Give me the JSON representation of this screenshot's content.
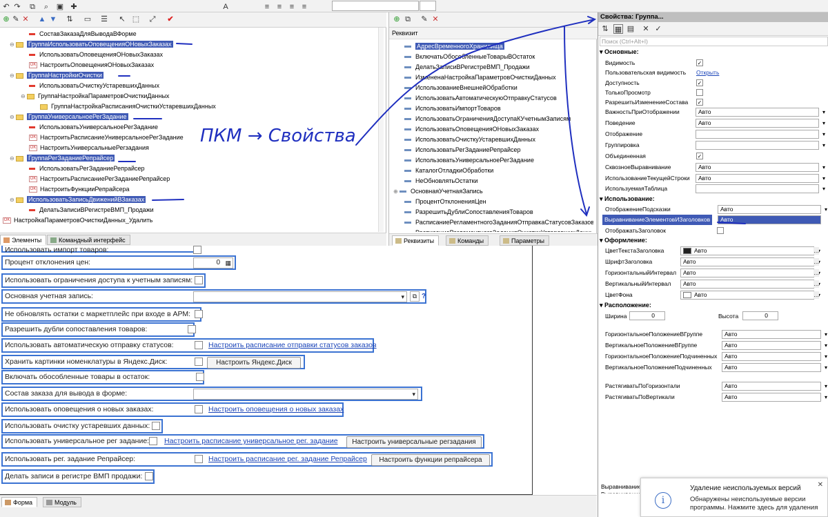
{
  "top_toolbar": {
    "field1": "",
    "field2": ""
  },
  "elements_tree": {
    "rows": [
      {
        "label": "СоставЗаказаДляВыводаВФорме",
        "icon": "red",
        "indent": 1
      },
      {
        "label": "ГруппаИспользоватьОповещенияОНовыхЗаказах",
        "icon": "folder",
        "indent": 0,
        "selected": true
      },
      {
        "label": "ИспользоватьОповещенияОНовыхЗаказах",
        "icon": "red",
        "indent": 1
      },
      {
        "label": "НастроитьОповещенияОНовыхЗаказах",
        "icon": "ok",
        "indent": 1
      },
      {
        "label": "ГруппаНастройкиОчистки",
        "icon": "folder",
        "indent": 0,
        "selected": true
      },
      {
        "label": "ИспользоватьОчисткуУстаревшихДанных",
        "icon": "red",
        "indent": 1
      },
      {
        "label": "ГруппаНастройкаПараметровОчисткиДанных",
        "icon": "folder",
        "indent": 1
      },
      {
        "label": "ГруппаНастройкаРасписанияОчисткиУстаревшихДанных",
        "icon": "folder",
        "indent": 2
      },
      {
        "label": "ГруппаУниверсальноеРегЗадание",
        "icon": "folder",
        "indent": 0,
        "selected": true
      },
      {
        "label": "ИспользоватьУниверсальноеРегЗадание",
        "icon": "red",
        "indent": 1
      },
      {
        "label": "НастроитьРасписаниеУниверсальноеРегЗадание",
        "icon": "ok",
        "indent": 1
      },
      {
        "label": "НастроитьУниверсальныеРегзадания",
        "icon": "ok",
        "indent": 1
      },
      {
        "label": "ГруппаРегЗаданиеРепрайсер",
        "icon": "folder",
        "indent": 0,
        "selected": true
      },
      {
        "label": "ИспользоватьРегЗаданиеРепрайсер",
        "icon": "red",
        "indent": 1
      },
      {
        "label": "НастроитьРасписаниеРегЗаданиеРепрайсер",
        "icon": "ok",
        "indent": 1
      },
      {
        "label": "НастроитьФункцииРепрайсера",
        "icon": "ok",
        "indent": 1
      },
      {
        "label": "ИспользоватьЗаписьДвиженийВЗаказах",
        "icon": "folder",
        "indent": 0,
        "selected": true
      },
      {
        "label": "ДелатьЗаписиВРегистреВМП_Продажи",
        "icon": "red",
        "indent": 1
      },
      {
        "label": "НастройкаПараметровОчисткиДанных_Удалить",
        "icon": "ok",
        "indent": -1
      }
    ],
    "tabs": [
      "Элементы",
      "Командный интерфейс"
    ]
  },
  "annotation": "ПКМ → Свойства",
  "requisites": {
    "header": "Реквизит",
    "rows": [
      "АдресВременногоХранилища",
      "ВключатьОбособленныеТоварыВОстаток",
      "ДелатьЗаписиВРегистреВМП_Продажи",
      "ИзмененаНастройкаПараметровОчисткиДанных",
      "ИспользованиеВнешнейОбработки",
      "ИспользоватьАвтоматическуюОтправкуСтатусов",
      "ИспользоватьИмпортТоваров",
      "ИспользоватьОграниченияДоступаКУчетнымЗаписям",
      "ИспользоватьОповещенияОНовыхЗаказах",
      "ИспользоватьОчисткуУстаревшихДанных",
      "ИспользоватьРегЗаданиеРепрайсер",
      "ИспользоватьУниверсальноеРегЗадание",
      "КаталогОтладкиОбработки",
      "НеОбновлятьОстатки",
      "ОсновнаяУчетнаяЗапись",
      "ПроцентОтклоненияЦен",
      "РазрешитьДублиСопоставленияТоваров",
      "РасписаниеРегламентногоЗаданияОтправкаСтатусовЗаказов",
      "РасписаниеРегламентногоЗаданияОчисткиУстаревшихДанных"
    ],
    "tabs": [
      "Реквизиты",
      "Команды",
      "Параметры"
    ]
  },
  "form": {
    "rows": [
      {
        "label": "Использовать импорт товаров:"
      },
      {
        "label": "Процент отклонения цен:",
        "value": "0"
      },
      {
        "label": "Использовать ограничения доступа к учетным записям:"
      },
      {
        "label": "Основная учетная запись:"
      },
      {
        "label": "Не обновлять остатки с маркетплейс при входе в АРМ:"
      },
      {
        "label": "Разрешить дубли сопоставления товаров:"
      },
      {
        "label": "Использовать автоматическую отправку статусов:",
        "link": "Настроить расписание отправки статусов заказов"
      },
      {
        "label": "Хранить картинки номенклатуры в Яндекс.Диск:",
        "button": "Настроить Яндекс.Диск"
      },
      {
        "label": "Включать обособленные товары в остаток:"
      },
      {
        "label": "Состав заказа для вывода в форме:"
      },
      {
        "label": "Использовать оповещения о новых заказах:",
        "link": "Настроить оповещения о новых заказах"
      },
      {
        "label": "Использовать очистку устаревших данных:"
      },
      {
        "label": "Использовать универсальное рег задание:",
        "link": "Настроить расписание универсальное рег. задание",
        "button": "Настроить универсальные регзадания"
      },
      {
        "label": "Использовать рег. задание Репрайсер:",
        "link": "Настроить расписание рег. задание Репрайсер",
        "button": "Настроить функции репрайсера"
      },
      {
        "label": "Делать записи в регистре ВМП продажи:"
      }
    ],
    "tabs": [
      "Форма",
      "Модуль"
    ]
  },
  "properties": {
    "title": "Свойства: Группа...",
    "search_placeholder": "Поиск (Ctrl+Alt+I)",
    "sections": {
      "main": "Основные:",
      "usage": "Использование:",
      "design": "Оформление:",
      "layout": "Расположение:"
    },
    "main_rows": [
      {
        "label": "Видимость",
        "type": "check",
        "checked": true
      },
      {
        "label": "Пользовательская видимость",
        "type": "link",
        "value": "Открыть"
      },
      {
        "label": "Доступность",
        "type": "check",
        "checked": true
      },
      {
        "label": "ТолькоПросмотр",
        "type": "check",
        "checked": false
      },
      {
        "label": "РазрешитьИзменениеСостава",
        "type": "check",
        "checked": true
      },
      {
        "label": "ВажностьПриОтображении",
        "type": "select",
        "value": "Авто"
      },
      {
        "label": "Поведение",
        "type": "select",
        "value": "Авто"
      },
      {
        "label": "Отображение",
        "type": "select",
        "value": ""
      },
      {
        "label": "Группировка",
        "type": "select",
        "value": ""
      },
      {
        "label": "Объединенная",
        "type": "check",
        "checked": true
      },
      {
        "label": "СквозноеВыравнивание",
        "type": "select",
        "value": "Авто"
      },
      {
        "label": "ИспользованиеТекущейСтроки",
        "type": "select",
        "value": "Авто"
      },
      {
        "label": "ИспользуемаяТаблица",
        "type": "select",
        "value": ""
      }
    ],
    "usage_rows": [
      {
        "label": "ОтображениеПодсказки",
        "value": "Авто"
      },
      {
        "label": "ВыравниваниеЭлементовИЗаголовков",
        "value": "Авто",
        "selected": true
      },
      {
        "label": "ОтображатьЗаголовок",
        "value": ""
      }
    ],
    "design_rows": [
      {
        "label": "ЦветТекстаЗаголовка",
        "value": "Авто",
        "swatch": "#222222"
      },
      {
        "label": "ШрифтЗаголовка",
        "value": "Авто"
      },
      {
        "label": "ГоризонтальныйИнтервал",
        "value": "Авто"
      },
      {
        "label": "ВертикальныйИнтервал",
        "value": "Авто"
      },
      {
        "label": "ЦветФона",
        "value": "Авто",
        "swatch": "#ffffff"
      }
    ],
    "layout": {
      "width_label": "Ширина",
      "width_value": "0",
      "height_label": "Высота",
      "height_value": "0",
      "rows": [
        {
          "label": "ГоризонтальноеПоложениеВГруппе",
          "value": "Авто"
        },
        {
          "label": "ВертикальноеПоложениеВГруппе",
          "value": "Авто"
        },
        {
          "label": "ГоризонтальноеПоложениеПодчиненных",
          "value": "Авто"
        },
        {
          "label": "ВертикальноеПоложениеПодчиненных",
          "value": "Авто"
        },
        {
          "label": "РастягиватьПоГоризонтали",
          "value": "Авто"
        },
        {
          "label": "РастягиватьПоВертикали",
          "value": "Авто"
        }
      ]
    },
    "bottom_label": "Выравнивание\nВыравнивание"
  },
  "notification": {
    "title": "Удаление неиспользуемых версий",
    "text": "Обнаружены неиспользуемые версии программы. Нажмите здесь для удаления"
  },
  "colors": {
    "accent": "#3a72d2",
    "selection": "#3f5ab5",
    "annotation": "#1f2fbf"
  }
}
